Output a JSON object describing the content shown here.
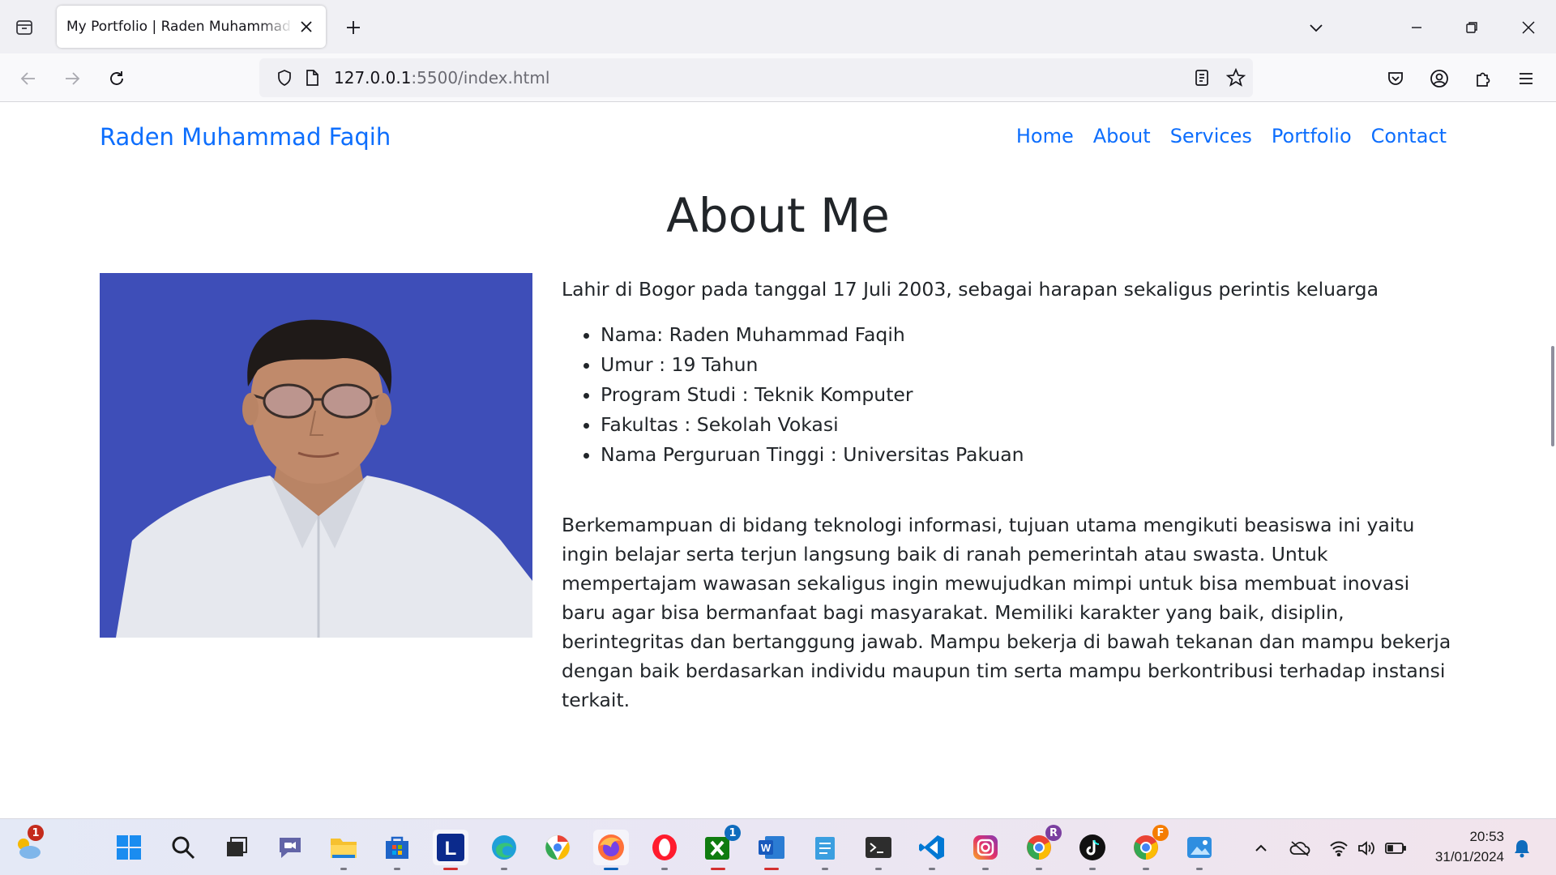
{
  "browser": {
    "tab_title": "My Portfolio | Raden Muhammad Faqih",
    "url_host": "127.0.0.1",
    "url_rest": ":5500/index.html"
  },
  "site": {
    "brand": "Raden Muhammad Faqih",
    "nav": [
      "Home",
      "About",
      "Services",
      "Portfolio",
      "Contact"
    ],
    "accent_color": "#0d6efd"
  },
  "about": {
    "title": "About Me",
    "intro": "Lahir di Bogor pada tanggal 17 Juli 2003, sebagai harapan sekaligus perintis keluarga",
    "details": [
      "Nama: Raden Muhammad Faqih",
      "Umur : 19 Tahun",
      "Program Studi : Teknik Komputer",
      "Fakultas : Sekolah Vokasi",
      "Nama Perguruan Tinggi : Universitas Pakuan"
    ],
    "description": "Berkemampuan di bidang teknologi informasi, tujuan utama mengikuti beasiswa ini yaitu ingin belajar serta terjun langsung baik di ranah pemerintah atau swasta. Untuk mempertajam wawasan sekaligus ingin mewujudkan mimpi untuk bisa membuat inovasi baru agar bisa bermanfaat bagi masyarakat. Memiliki karakter yang baik, disiplin, berintegritas dan bertanggung jawab. Mampu bekerja di bawah tekanan dan mampu bekerja dengan baik berdasarkan individu maupun tim serta mampu berkontribusi terhadap instansi terkait.",
    "photo_background": "#3e4eb8"
  },
  "taskbar": {
    "weather_badge": "1",
    "xbox_badge": "1",
    "chrome_profile_r": "R",
    "chrome_profile_f": "F",
    "time": "20:53",
    "date": "31/01/2024"
  }
}
